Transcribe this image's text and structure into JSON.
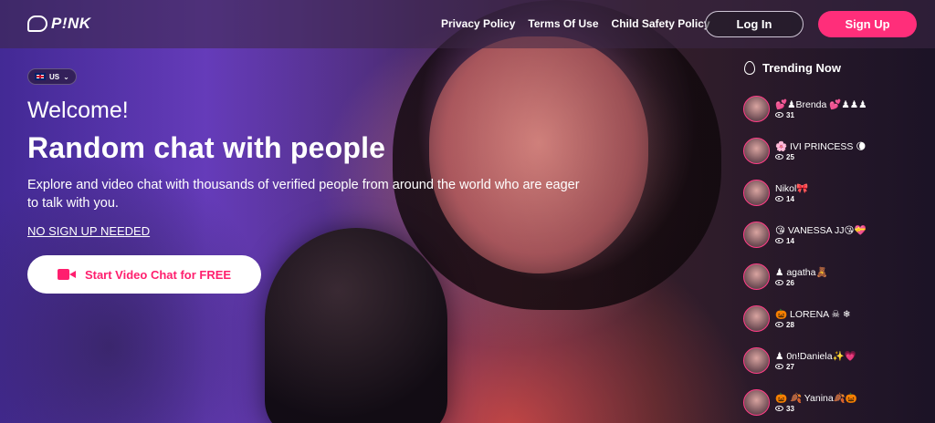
{
  "brand": {
    "logo_text": "P!NK"
  },
  "nav": {
    "links": [
      "Privacy Policy",
      "Terms Of Use",
      "Child Safety Policy"
    ],
    "login_label": "Log In",
    "signup_label": "Sign Up"
  },
  "language": {
    "code": "US",
    "icon": "uk-flag-icon"
  },
  "hero": {
    "welcome": "Welcome!",
    "headline": "Random chat with people",
    "description": "Explore and video chat with thousands of verified people from around the world who are eager to talk with you.",
    "no_signup": "NO SIGN UP NEEDED",
    "cta_label": "Start Video Chat for FREE"
  },
  "trending": {
    "title": "Trending Now",
    "items": [
      {
        "name": "💕♟Brenda 💕♟♟♟",
        "views": "31"
      },
      {
        "name": "🌸 IVI PRINCESS 🌘",
        "views": "25"
      },
      {
        "name": "Nikol🎀",
        "views": "14"
      },
      {
        "name": "😘 VANESSA JJ😘💝",
        "views": "14"
      },
      {
        "name": "♟ agatha🧸",
        "views": "26"
      },
      {
        "name": "🎃 LORENA ☠ ❄",
        "views": "28"
      },
      {
        "name": "♟ 0n!Daniela✨💗",
        "views": "27"
      },
      {
        "name": "🎃 🍂 Yanina🍂🎃",
        "views": "33"
      }
    ]
  },
  "colors": {
    "accent": "#ff2e7a",
    "cta_text": "#ff1f6e"
  }
}
